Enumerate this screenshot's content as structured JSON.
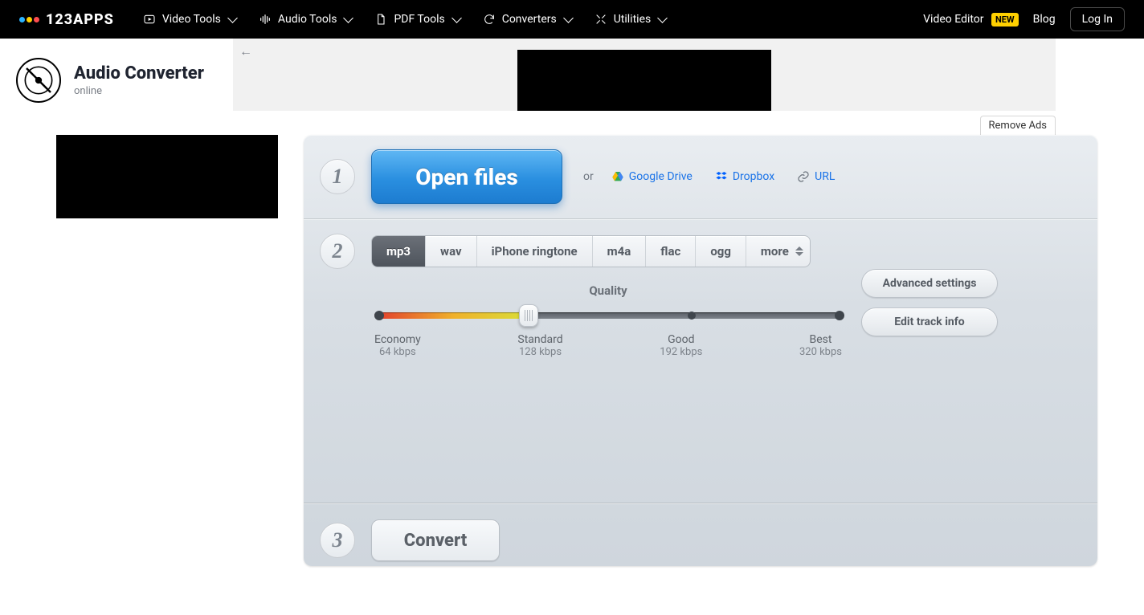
{
  "nav": {
    "brand": "123APPS",
    "items": [
      {
        "label": "Video Tools"
      },
      {
        "label": "Audio Tools"
      },
      {
        "label": "PDF Tools"
      },
      {
        "label": "Converters"
      },
      {
        "label": "Utilities"
      }
    ],
    "video_editor": "Video Editor",
    "new_badge": "NEW",
    "blog": "Blog",
    "login": "Log In"
  },
  "app": {
    "title": "Audio Converter",
    "subtitle": "online"
  },
  "ads": {
    "remove": "Remove Ads"
  },
  "step1": {
    "num": "1",
    "open_files": "Open files",
    "or": "or",
    "google_drive": "Google Drive",
    "dropbox": "Dropbox",
    "url": "URL"
  },
  "step2": {
    "num": "2",
    "formats": [
      "mp3",
      "wav",
      "iPhone ringtone",
      "m4a",
      "flac",
      "ogg",
      "more"
    ],
    "selected_format_index": 0,
    "quality_title": "Quality",
    "levels": [
      {
        "name": "Economy",
        "rate": "64 kbps"
      },
      {
        "name": "Standard",
        "rate": "128 kbps"
      },
      {
        "name": "Good",
        "rate": "192 kbps"
      },
      {
        "name": "Best",
        "rate": "320 kbps"
      }
    ],
    "advanced": "Advanced settings",
    "edit_track": "Edit track info"
  },
  "step3": {
    "num": "3",
    "convert": "Convert"
  },
  "colors": {
    "brand_dots": [
      "#ff4d4f",
      "#ffd000",
      "#2bb3ff"
    ],
    "accent_blue": "#2a8fe0"
  }
}
